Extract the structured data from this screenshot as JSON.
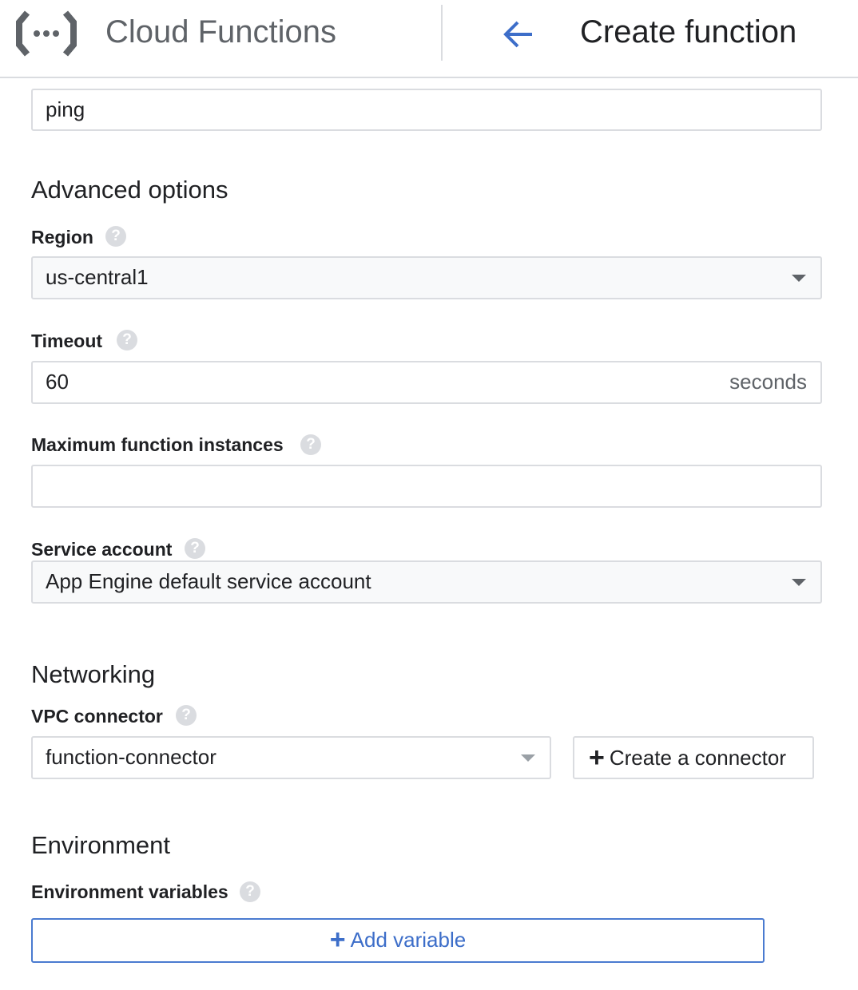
{
  "header": {
    "app_title": "Cloud Functions",
    "page_title": "Create function",
    "logo_icon": "cloud-functions-icon",
    "back_icon": "arrow-back-icon",
    "accent_color": "#4a7bd0"
  },
  "entry_point": {
    "value": "ping"
  },
  "advanced": {
    "section_title": "Advanced options",
    "region": {
      "label": "Region",
      "value": "us-central1"
    },
    "timeout": {
      "label": "Timeout",
      "value": "60",
      "suffix": "seconds"
    },
    "max_instances": {
      "label": "Maximum function instances",
      "value": ""
    },
    "service_account": {
      "label": "Service account",
      "value": "App Engine default service account"
    }
  },
  "networking": {
    "section_title": "Networking",
    "vpc": {
      "label": "VPC connector",
      "value": "function-connector"
    },
    "create_connector_label": "Create a connector"
  },
  "environment": {
    "section_title": "Environment",
    "variables_label": "Environment variables",
    "add_variable_label": "Add variable"
  },
  "help_glyph": "?"
}
